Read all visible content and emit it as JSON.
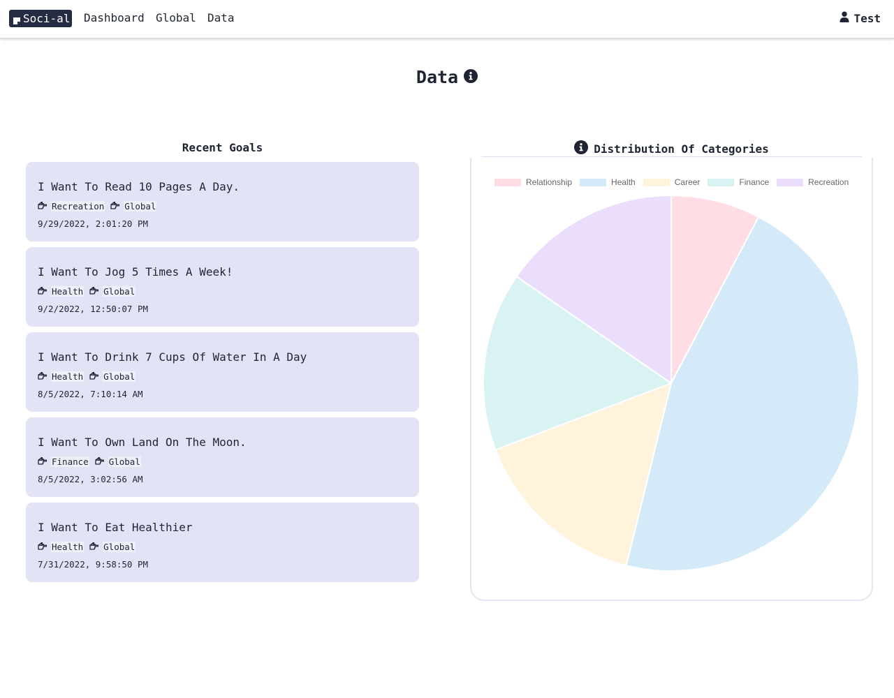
{
  "navbar": {
    "brand": "Soci-al",
    "links": [
      "Dashboard",
      "Global",
      "Data"
    ],
    "user": "Test"
  },
  "page": {
    "title": "Data"
  },
  "recent_goals": {
    "title": "Recent Goals",
    "items": [
      {
        "title": "I Want To Read 10 Pages A Day.",
        "category": "Recreation",
        "visibility": "Global",
        "date": "9/29/2022, 2:01:20 PM"
      },
      {
        "title": "I Want To Jog 5 Times A Week!",
        "category": "Health",
        "visibility": "Global",
        "date": "9/2/2022, 12:50:07 PM"
      },
      {
        "title": "I Want To Drink 7 Cups Of Water In A Day",
        "category": "Health",
        "visibility": "Global",
        "date": "8/5/2022, 7:10:14 AM"
      },
      {
        "title": "I Want To Own Land On The Moon.",
        "category": "Finance",
        "visibility": "Global",
        "date": "8/5/2022, 3:02:56 AM"
      },
      {
        "title": "I Want To Eat Healthier",
        "category": "Health",
        "visibility": "Global",
        "date": "7/31/2022, 9:58:50 PM"
      }
    ]
  },
  "chart_section": {
    "title": "Distribution Of Categories"
  },
  "chart_data": {
    "type": "pie",
    "title": "Distribution Of Categories",
    "categories": [
      "Relationship",
      "Health",
      "Career",
      "Finance",
      "Recreation"
    ],
    "values": [
      1,
      6,
      2,
      2,
      2
    ],
    "colors": {
      "fill": [
        "#ffdde4",
        "#d4eaf8",
        "#fff3dc",
        "#d9f2f2",
        "#ebddfc"
      ],
      "border": [
        "#ffb8c8",
        "#9fd0f2",
        "#ffdfa3",
        "#a9e4e4",
        "#cdb5fa"
      ]
    },
    "legend": "top"
  },
  "icons": {
    "brand": "note-icon",
    "user": "user-icon",
    "info": "info-circle-icon",
    "tag": "hand-point-right-icon"
  }
}
